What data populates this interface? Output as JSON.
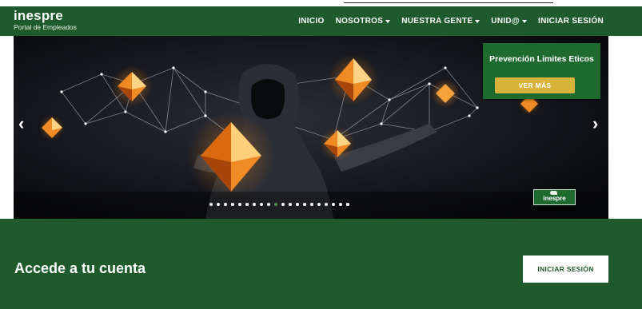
{
  "brand": {
    "name": "inespre",
    "subtitle": "Portal de Empleados"
  },
  "nav": {
    "items": [
      {
        "label": "INICIO",
        "dropdown": false
      },
      {
        "label": "NOSOTROS",
        "dropdown": true
      },
      {
        "label": "NUESTRA GENTE",
        "dropdown": true
      },
      {
        "label": "UNID@",
        "dropdown": true
      },
      {
        "label": "INICIAR SESIÓN",
        "dropdown": false
      }
    ]
  },
  "carousel": {
    "promo_title": "Prevención Limites Eticos",
    "promo_button": "VER MÁS",
    "prev_arrow": "‹",
    "next_arrow": "›",
    "logo_text": "inespre",
    "slide_count": 20,
    "active_slide": 9
  },
  "footer": {
    "title": "Accede a tu cuenta",
    "login_button": "INICIAR SESIÓN"
  },
  "colors": {
    "brand_green": "#1e5a2c",
    "promo_green": "#1f6a2e",
    "accent_gold": "#d8b33a"
  },
  "icons": [
    "chevron-left-icon",
    "chevron-right-icon",
    "caret-down-icon",
    "inespre-logo-icon"
  ]
}
